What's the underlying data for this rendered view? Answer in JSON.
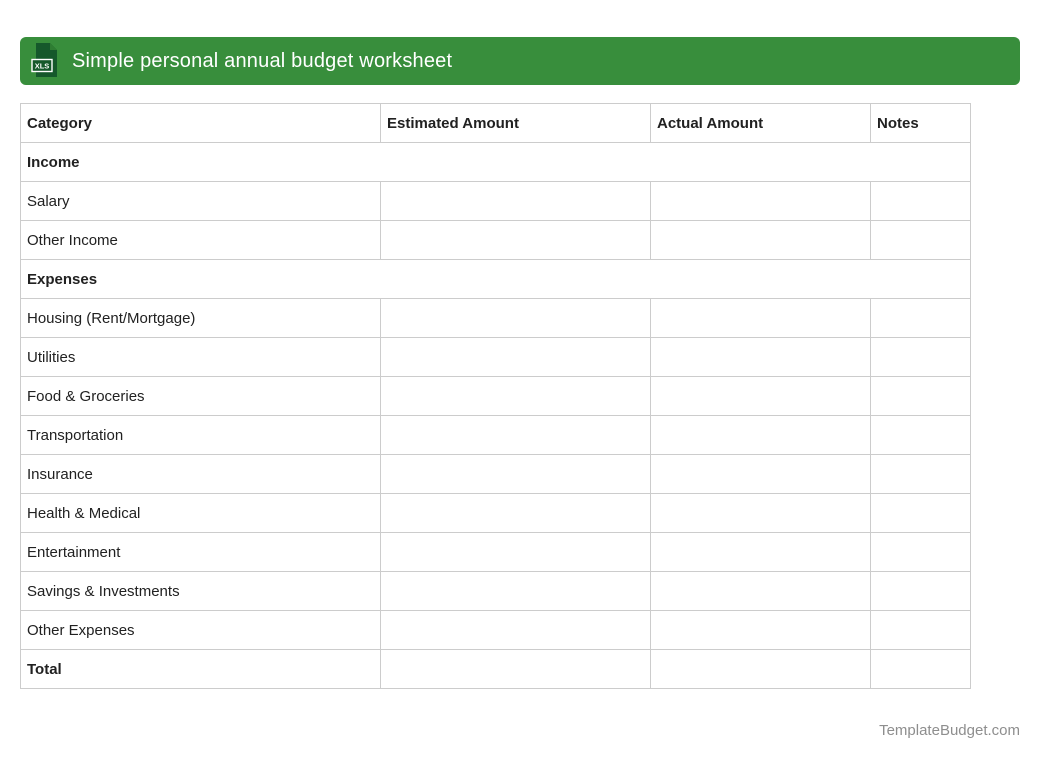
{
  "header": {
    "title": "Simple personal annual budget worksheet",
    "file_badge": "XLS"
  },
  "table": {
    "columns": [
      "Category",
      "Estimated Amount",
      "Actual Amount",
      "Notes"
    ],
    "rows": [
      {
        "label": "Income",
        "type": "section",
        "estimated": "",
        "actual": "",
        "notes": ""
      },
      {
        "label": "Salary",
        "type": "item",
        "estimated": "",
        "actual": "",
        "notes": ""
      },
      {
        "label": "Other Income",
        "type": "item",
        "estimated": "",
        "actual": "",
        "notes": ""
      },
      {
        "label": "Expenses",
        "type": "section",
        "estimated": "",
        "actual": "",
        "notes": ""
      },
      {
        "label": "Housing (Rent/Mortgage)",
        "type": "item",
        "estimated": "",
        "actual": "",
        "notes": ""
      },
      {
        "label": "Utilities",
        "type": "item",
        "estimated": "",
        "actual": "",
        "notes": ""
      },
      {
        "label": "Food & Groceries",
        "type": "item",
        "estimated": "",
        "actual": "",
        "notes": ""
      },
      {
        "label": "Transportation",
        "type": "item",
        "estimated": "",
        "actual": "",
        "notes": ""
      },
      {
        "label": "Insurance",
        "type": "item",
        "estimated": "",
        "actual": "",
        "notes": ""
      },
      {
        "label": "Health & Medical",
        "type": "item",
        "estimated": "",
        "actual": "",
        "notes": ""
      },
      {
        "label": "Entertainment",
        "type": "item",
        "estimated": "",
        "actual": "",
        "notes": ""
      },
      {
        "label": "Savings & Investments",
        "type": "item",
        "estimated": "",
        "actual": "",
        "notes": ""
      },
      {
        "label": "Other Expenses",
        "type": "item",
        "estimated": "",
        "actual": "",
        "notes": ""
      },
      {
        "label": "Total",
        "type": "total",
        "estimated": "",
        "actual": "",
        "notes": ""
      }
    ]
  },
  "footer": {
    "text": "TemplateBudget.com"
  },
  "colors": {
    "banner_green": "#388e3c",
    "icon_document_green": "#15582b",
    "icon_fold_green": "#2e7d32",
    "table_border": "#cccccc",
    "body_text": "#212121",
    "footer_text": "#8e8e8e"
  }
}
